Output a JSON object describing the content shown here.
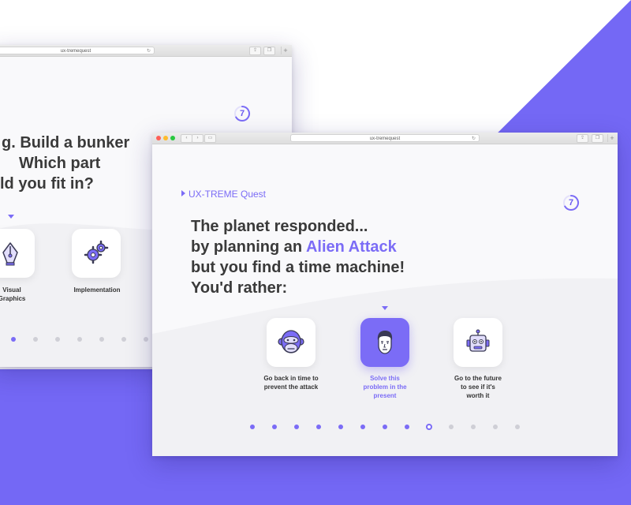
{
  "colors": {
    "accent": "#7b6cf6",
    "dot_active": "#7b6cf6",
    "dot_inactive": "#cfcfd6",
    "background_purple": "#7468f5"
  },
  "back_window": {
    "url": "ux-tremequest",
    "level_badge": "7",
    "heading_lines": [
      "g. Build a bunker",
      "Which part",
      "ld you fit in?"
    ],
    "options": [
      {
        "label": "Visual\nGraphics",
        "icon": "pen-nib-icon"
      },
      {
        "label": "Implementation",
        "icon": "gears-icon"
      }
    ],
    "progress": {
      "total": 7,
      "active_index": 0
    }
  },
  "front_window": {
    "url": "ux-tremequest",
    "brand": "UX-TREME Quest",
    "level_badge": "7",
    "heading": {
      "line1": "The planet responded...",
      "line2_prefix": "by planning an ",
      "line2_highlight": "Alien Attack",
      "line3": "but you find a time machine!",
      "line4": "You'd rather:"
    },
    "options": [
      {
        "label": "Go back in time to prevent the attack",
        "icon": "monkey-icon",
        "selected": false
      },
      {
        "label": "Solve this problem in the present",
        "icon": "human-face-icon",
        "selected": true
      },
      {
        "label": "Go to the future to see if it's worth it",
        "icon": "robot-icon",
        "selected": false
      }
    ],
    "progress": {
      "total": 13,
      "current_index": 8,
      "completed_count": 8
    }
  }
}
